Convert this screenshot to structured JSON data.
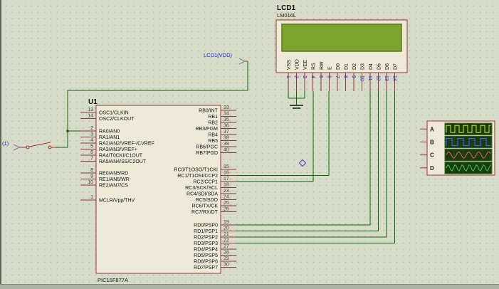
{
  "schematic": {
    "mcu": {
      "ref": "U1",
      "value": "PIC16F877A",
      "left_pin_groups": [
        [
          {
            "num": "13",
            "name": "OSC1/CLKIN"
          },
          {
            "num": "14",
            "name": "OSC2/CLKOUT"
          }
        ],
        [
          {
            "num": "2",
            "name": "RA0/AN0"
          },
          {
            "num": "3",
            "name": "RA1/AN1"
          },
          {
            "num": "4",
            "name": "RA2/AN2/VREF-/CVREF"
          },
          {
            "num": "5",
            "name": "RA3/AN3/VREF+"
          },
          {
            "num": "6",
            "name": "RA4/T0CKI/C1OUT"
          },
          {
            "num": "7",
            "name": "RA5/AN4/SS/C2OUT"
          }
        ],
        [
          {
            "num": "8",
            "name": "RE0/AN5/RD"
          },
          {
            "num": "9",
            "name": "RE1/AN6/WR"
          },
          {
            "num": "10",
            "name": "RE2/AN7/CS"
          }
        ],
        [
          {
            "num": "1",
            "name": "MCLR/Vpp/THV"
          }
        ]
      ],
      "right_pin_groups": [
        [
          {
            "num": "33",
            "name": "RB0/INT"
          },
          {
            "num": "34",
            "name": "RB1"
          },
          {
            "num": "35",
            "name": "RB2"
          },
          {
            "num": "36",
            "name": "RB3/PGM"
          },
          {
            "num": "37",
            "name": "RB4"
          },
          {
            "num": "38",
            "name": "RB5"
          },
          {
            "num": "39",
            "name": "RB6/PGC"
          },
          {
            "num": "40",
            "name": "RB7/PGD"
          }
        ],
        [
          {
            "num": "15",
            "name": "RC0/T1OSO/T1CKI"
          },
          {
            "num": "16",
            "name": "RC1/T1OSI/CCP2"
          },
          {
            "num": "17",
            "name": "RC2/CCP1"
          },
          {
            "num": "18",
            "name": "RC3/SCK/SCL"
          },
          {
            "num": "23",
            "name": "RC4/SDI/SDA"
          },
          {
            "num": "24",
            "name": "RC5/SDO"
          },
          {
            "num": "25",
            "name": "RC6/TX/CK"
          },
          {
            "num": "26",
            "name": "RC7/RX/DT"
          }
        ],
        [
          {
            "num": "19",
            "name": "RD0/PSP0"
          },
          {
            "num": "20",
            "name": "RD1/PSP1"
          },
          {
            "num": "21",
            "name": "RD2/PSP2"
          },
          {
            "num": "22",
            "name": "RD3/PSP3"
          },
          {
            "num": "27",
            "name": "RD4/PSP4"
          },
          {
            "num": "28",
            "name": "RD5/PSP5"
          },
          {
            "num": "29",
            "name": "RD6/PSP6"
          },
          {
            "num": "30",
            "name": "RD7/PSP7"
          }
        ]
      ]
    },
    "lcd": {
      "ref": "LCD1",
      "value": "LM016L",
      "pins": [
        {
          "num": "1",
          "name": "VSS"
        },
        {
          "num": "2",
          "name": "VDD"
        },
        {
          "num": "3",
          "name": "VEE"
        },
        {
          "num": "4",
          "name": "RS"
        },
        {
          "num": "5",
          "name": "RW"
        },
        {
          "num": "6",
          "name": "E"
        },
        {
          "num": "7",
          "name": "D0"
        },
        {
          "num": "8",
          "name": "D1"
        },
        {
          "num": "9",
          "name": "D2"
        },
        {
          "num": "10",
          "name": "D3"
        },
        {
          "num": "11",
          "name": "D4"
        },
        {
          "num": "12",
          "name": "D5"
        },
        {
          "num": "13",
          "name": "D6"
        },
        {
          "num": "14",
          "name": "D7"
        }
      ]
    },
    "scope": {
      "channels": [
        {
          "label": "A",
          "wave": "square",
          "period": 12,
          "trace_color": "#e2e200"
        },
        {
          "label": "B",
          "wave": "square",
          "period": 16,
          "trace_color": "#5a5aff"
        },
        {
          "label": "C",
          "wave": "sine",
          "period": 14,
          "trace_color": "#ff5555"
        },
        {
          "label": "D",
          "wave": "sine",
          "period": 10,
          "trace_color": "#44cc44"
        }
      ]
    },
    "labels": {
      "power_terminal": "LCD1(VDD)",
      "input_terminal": "(1)"
    }
  },
  "colors": {
    "canvas_background": "#d7dcc9",
    "grid_dot": "#b7bfa6",
    "component_outline": "#9e3232",
    "component_fill": "#eeead8",
    "wire": "#086808",
    "label_blue": "#2424cc",
    "lcd_screen": "#7aa42c",
    "scope_screen": "#173c10"
  }
}
